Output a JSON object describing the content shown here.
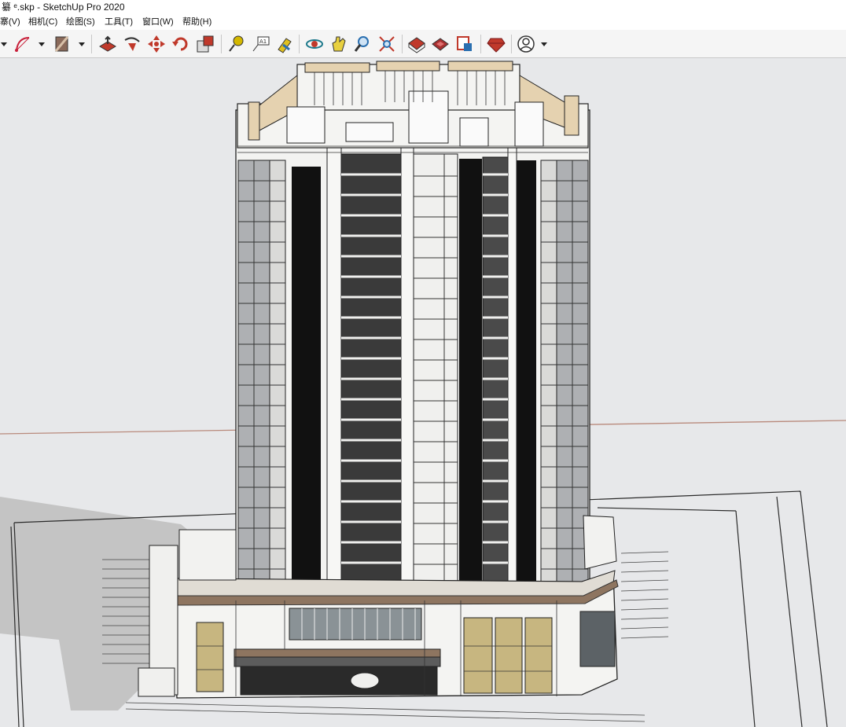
{
  "window": {
    "title": "纂 ᵉ.skp - SketchUp Pro 2020"
  },
  "menu": {
    "items": [
      "寨(V)",
      "相机(C)",
      "绘图(S)",
      "工具(T)",
      "窗口(W)",
      "帮助(H)"
    ]
  },
  "toolbar": {
    "tools": [
      "arc-icon",
      "paint-bucket-icon",
      "push-pull-icon",
      "follow-me-icon",
      "move-icon",
      "rotate-icon",
      "scale-icon",
      "tape-measure-icon",
      "text-label-icon",
      "paint-brush-icon",
      "orbit-icon",
      "pan-icon",
      "zoom-icon",
      "zoom-extents-icon",
      "warehouse-icon",
      "extension-warehouse-icon",
      "send-to-layout-icon",
      "ruby-icon",
      "account-icon"
    ]
  },
  "colors": {
    "background": "#e7e8ea",
    "building_white": "#f4f4f2",
    "glass_dark": "#111111",
    "beige_trim": "#e5d2b0",
    "brown_band": "#8e7560",
    "shadow": "#c5c5c5",
    "window_amber": "#c7b680"
  }
}
